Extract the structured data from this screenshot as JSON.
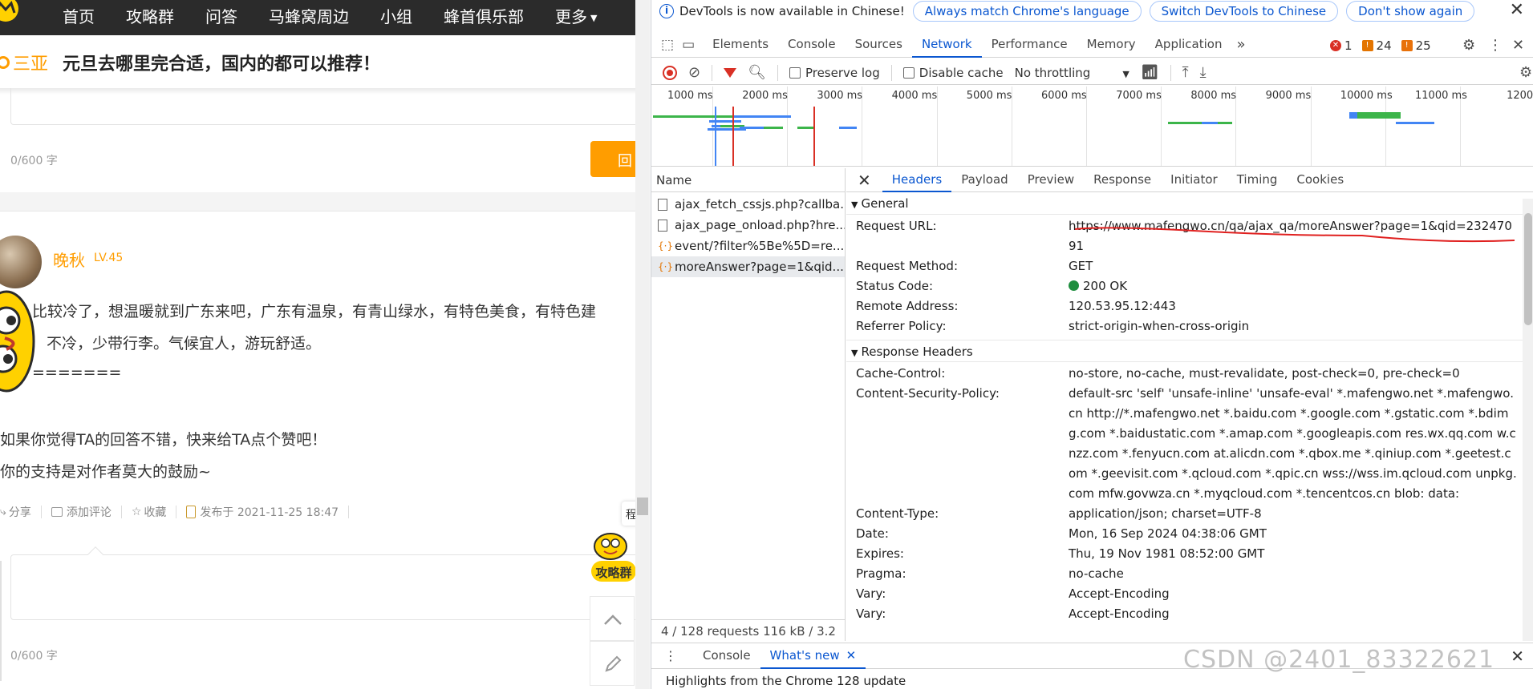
{
  "site": {
    "nav": [
      "首页",
      "攻略群",
      "问答",
      "马蜂窝周边",
      "小组",
      "蜂首俱乐部",
      "更多"
    ],
    "question_city": "三亚",
    "question_title": "元旦去哪里完合适，国内的都可以推荐！",
    "char_count_1": "0/600 字",
    "reply_label": "回",
    "answer": {
      "user_name": "晚秋",
      "user_level": "LV.45",
      "lines": [
        "比较冷了，想温暖就到广东来吧，广东有温泉，有青山绿水，有特色美食，有特色建",
        "不冷，少带行李。气候宜人，游玩舒适。",
        "=======",
        "如果你觉得TA的回答不错，快来给TA点个赞吧！",
        "你的支持是对作者莫大的鼓励~"
      ]
    },
    "meta": {
      "share": "分享",
      "comment": "添加评论",
      "fav": "收藏",
      "published": "发布于 2021-11-25 18:47"
    },
    "char_count_2": "0/600 字",
    "side_tip": "程",
    "side_badge": "攻略群"
  },
  "devtools": {
    "infobar": {
      "message": "DevTools is now available in Chinese!",
      "btn_match": "Always match Chrome's language",
      "btn_switch": "Switch DevTools to Chinese",
      "btn_dismiss": "Don't show again"
    },
    "tabs": [
      "Elements",
      "Console",
      "Sources",
      "Network",
      "Performance",
      "Memory",
      "Application"
    ],
    "active_tab": "Network",
    "issue_counts": {
      "errors": "1",
      "warnings": "24",
      "info": "25"
    },
    "toolbar": {
      "preserve_log": "Preserve log",
      "disable_cache": "Disable cache",
      "throttling": "No throttling"
    },
    "timeline_labels": [
      "1000 ms",
      "2000 ms",
      "3000 ms",
      "4000 ms",
      "5000 ms",
      "6000 ms",
      "7000 ms",
      "8000 ms",
      "9000 ms",
      "10000 ms",
      "11000 ms",
      "1200"
    ],
    "name_header": "Name",
    "requests": [
      {
        "name": "ajax_fetch_cssjs.php?callba...",
        "type": "doc"
      },
      {
        "name": "ajax_page_onload.php?hre...",
        "type": "doc"
      },
      {
        "name": "event/?filter%5Be%5D=re...",
        "type": "xhr"
      },
      {
        "name": "moreAnswer?page=1&qid...",
        "type": "xhr",
        "selected": true
      }
    ],
    "status_bar": "4 / 128 requests   116 kB / 3.2",
    "detail_tabs": [
      "Headers",
      "Payload",
      "Preview",
      "Response",
      "Initiator",
      "Timing",
      "Cookies"
    ],
    "active_detail_tab": "Headers",
    "general_title": "General",
    "general": [
      {
        "k": "Request URL:",
        "v": "https://www.mafengwo.cn/qa/ajax_qa/moreAnswer?page=1&qid=23247091"
      },
      {
        "k": "Request Method:",
        "v": "GET"
      },
      {
        "k": "Status Code:",
        "v": "200 OK"
      },
      {
        "k": "Remote Address:",
        "v": "120.53.95.12:443"
      },
      {
        "k": "Referrer Policy:",
        "v": "strict-origin-when-cross-origin"
      }
    ],
    "response_title": "Response Headers",
    "response": [
      {
        "k": "Cache-Control:",
        "v": "no-store, no-cache, must-revalidate, post-check=0, pre-check=0"
      },
      {
        "k": "Content-Security-Policy:",
        "v": "default-src 'self' 'unsafe-inline' 'unsafe-eval' *.mafengwo.net *.mafengwo.cn http://*.mafengwo.net *.baidu.com *.google.com *.gstatic.com *.bdimg.com *.baidustatic.com *.amap.com *.googleapis.com res.wx.qq.com w.cnzz.com *.fenyucn.com at.alicdn.com *.qbox.me *.qiniup.com *.geetest.com *.geevisit.com *.qcloud.com *.qpic.cn wss://wss.im.qcloud.com unpkg.com mfw.govwza.cn *.myqcloud.com *.tencentcos.cn blob: data:"
      },
      {
        "k": "Content-Type:",
        "v": "application/json; charset=UTF-8"
      },
      {
        "k": "Date:",
        "v": "Mon, 16 Sep 2024 04:38:06 GMT"
      },
      {
        "k": "Expires:",
        "v": "Thu, 19 Nov 1981 08:52:00 GMT"
      },
      {
        "k": "Pragma:",
        "v": "no-cache"
      },
      {
        "k": "Vary:",
        "v": "Accept-Encoding"
      },
      {
        "k": "Vary:",
        "v": "Accept-Encoding"
      }
    ],
    "drawer_tabs": [
      "Console",
      "What's new"
    ],
    "drawer_active": "What's new",
    "drawer_text": "Highlights from the Chrome 128 update"
  },
  "watermark": "CSDN @2401_83322621",
  "colors": {
    "accent": "#ff9d00",
    "devtools_blue": "#0b57d0",
    "nav_bg": "#2b2b2b"
  }
}
